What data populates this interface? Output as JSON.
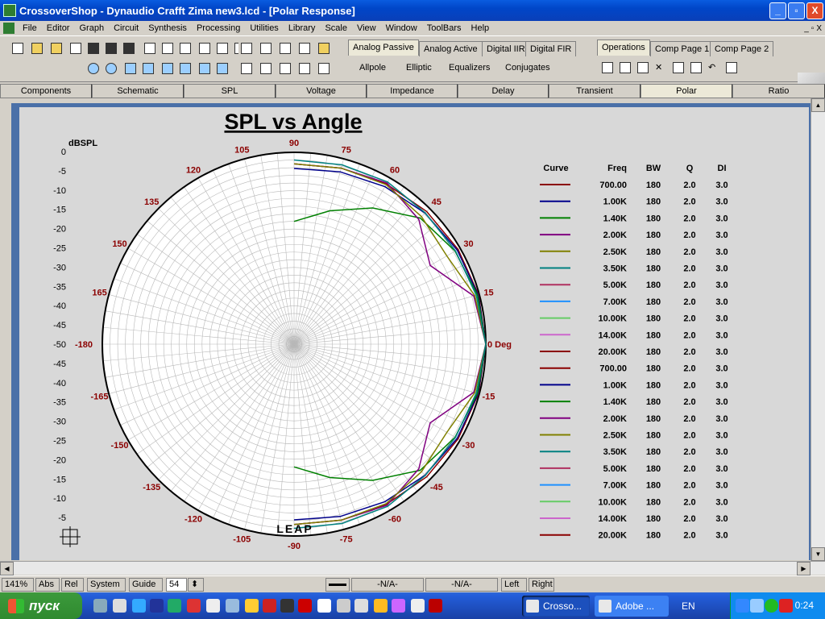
{
  "window": {
    "title": "CrossoverShop - Dynaudio Crafft Zima new3.lcd - [Polar Response]",
    "min": "_",
    "max": "▫",
    "close": "X"
  },
  "menu": [
    "File",
    "Editor",
    "Graph",
    "Circuit",
    "Synthesis",
    "Processing",
    "Utilities",
    "Library",
    "Scale",
    "View",
    "Window",
    "ToolBars",
    "Help"
  ],
  "mdi_controls": [
    "_",
    "▫",
    "X"
  ],
  "toolbar": {
    "tabs_top": [
      "Analog Passive",
      "Analog Active",
      "Digital IIR",
      "Digital FIR"
    ],
    "tabs_bottom": [
      "Allpole",
      "Elliptic",
      "Equalizers",
      "Conjugates"
    ],
    "ops_tabs": [
      "Operations",
      "Comp Page 1",
      "Comp Page 2"
    ]
  },
  "page_tabs": [
    "Components",
    "Schematic",
    "SPL",
    "Voltage",
    "Impedance",
    "Delay",
    "Transient",
    "Polar",
    "Ratio"
  ],
  "selected_page_tab": "Polar",
  "chart_data": {
    "type": "polar",
    "title": "SPL vs Angle",
    "radial_unit": "dBSPL",
    "radial_labels_upper": [
      "0",
      "-5",
      "-10",
      "-15",
      "-20",
      "-25",
      "-30",
      "-35",
      "-40",
      "-45",
      "-50"
    ],
    "radial_labels_lower": [
      "-45",
      "-40",
      "-35",
      "-30",
      "-25",
      "-20",
      "-15",
      "-10",
      "-5"
    ],
    "radial_range": [
      -50,
      0
    ],
    "angle_labels": [
      "90",
      "75",
      "60",
      "45",
      "30",
      "15",
      "0 Deg",
      "-15",
      "-30",
      "-45",
      "-60",
      "-75",
      "-90",
      "-105",
      "-120",
      "-135",
      "-150",
      "-165",
      "-180",
      "165",
      "150",
      "135",
      "120",
      "105"
    ],
    "angles": [
      0,
      15,
      30,
      45,
      60,
      75,
      90
    ],
    "grid": true,
    "watermark": "LEAP",
    "legend_headers": [
      "Curve",
      "Freq",
      "BW",
      "Q",
      "DI"
    ],
    "series": [
      {
        "freq": "700.00",
        "bw": "180",
        "q": "2.0",
        "di": "3.0",
        "color": "#8b0000",
        "db": [
          0,
          -0.2,
          -0.6,
          -1.1,
          -1.8,
          -2.5,
          -3.0
        ]
      },
      {
        "freq": "1.00K",
        "bw": "180",
        "q": "2.0",
        "di": "3.0",
        "color": "#00008b",
        "db": [
          0,
          -0.3,
          -0.9,
          -1.7,
          -2.6,
          -3.5,
          -4.2
        ]
      },
      {
        "freq": "1.40K",
        "bw": "180",
        "q": "2.0",
        "di": "3.0",
        "color": "#008000",
        "db": [
          0,
          -0.5,
          -1.5,
          -3.5,
          -9,
          -14,
          -18
        ]
      },
      {
        "freq": "2.00K",
        "bw": "180",
        "q": "2.0",
        "di": "3.0",
        "color": "#800080",
        "db": [
          0,
          -1.5,
          -9,
          -4,
          -1.5,
          -2.5,
          -3.0
        ]
      },
      {
        "freq": "2.50K",
        "bw": "180",
        "q": "2.0",
        "di": "3.0",
        "color": "#808000",
        "db": [
          0,
          -1.2,
          -4,
          -3,
          -2,
          -2.5,
          -3.0
        ]
      },
      {
        "freq": "3.50K",
        "bw": "180",
        "q": "2.0",
        "di": "3.0",
        "color": "#008080",
        "db": [
          0,
          -0.8,
          -1.4,
          -1.6,
          -1.2,
          -1.6,
          -2.0
        ]
      },
      {
        "freq": "5.00K",
        "bw": "180",
        "q": "2.0",
        "di": "3.0",
        "color": "#b03060",
        "db": []
      },
      {
        "freq": "7.00K",
        "bw": "180",
        "q": "2.0",
        "di": "3.0",
        "color": "#1e90ff",
        "db": []
      },
      {
        "freq": "10.00K",
        "bw": "180",
        "q": "2.0",
        "di": "3.0",
        "color": "#66cc66",
        "db": []
      },
      {
        "freq": "14.00K",
        "bw": "180",
        "q": "2.0",
        "di": "3.0",
        "color": "#cc66cc",
        "db": []
      },
      {
        "freq": "20.00K",
        "bw": "180",
        "q": "2.0",
        "di": "3.0",
        "color": "#8b0000",
        "db": []
      },
      {
        "freq": "700.00",
        "bw": "180",
        "q": "2.0",
        "di": "3.0",
        "color": "#8b0000",
        "db": []
      },
      {
        "freq": "1.00K",
        "bw": "180",
        "q": "2.0",
        "di": "3.0",
        "color": "#00008b",
        "db": []
      },
      {
        "freq": "1.40K",
        "bw": "180",
        "q": "2.0",
        "di": "3.0",
        "color": "#008000",
        "db": []
      },
      {
        "freq": "2.00K",
        "bw": "180",
        "q": "2.0",
        "di": "3.0",
        "color": "#800080",
        "db": []
      },
      {
        "freq": "2.50K",
        "bw": "180",
        "q": "2.0",
        "di": "3.0",
        "color": "#808000",
        "db": []
      },
      {
        "freq": "3.50K",
        "bw": "180",
        "q": "2.0",
        "di": "3.0",
        "color": "#008080",
        "db": []
      },
      {
        "freq": "5.00K",
        "bw": "180",
        "q": "2.0",
        "di": "3.0",
        "color": "#b03060",
        "db": []
      },
      {
        "freq": "7.00K",
        "bw": "180",
        "q": "2.0",
        "di": "3.0",
        "color": "#1e90ff",
        "db": []
      },
      {
        "freq": "10.00K",
        "bw": "180",
        "q": "2.0",
        "di": "3.0",
        "color": "#66cc66",
        "db": []
      },
      {
        "freq": "14.00K",
        "bw": "180",
        "q": "2.0",
        "di": "3.0",
        "color": "#cc66cc",
        "db": []
      },
      {
        "freq": "20.00K",
        "bw": "180",
        "q": "2.0",
        "di": "3.0",
        "color": "#8b0000",
        "db": []
      }
    ]
  },
  "status": {
    "zoom": "141%",
    "abs": "Abs",
    "rel": "Rel",
    "system": "System",
    "guide": "Guide",
    "value": "54",
    "na1": "-N/A-",
    "na2": "-N/A-",
    "left": "Left",
    "right": "Right"
  },
  "taskbar": {
    "start": "пуск",
    "tasks": [
      "Crosso...",
      "Adobe ..."
    ],
    "lang": "EN",
    "clock": "0:24"
  }
}
